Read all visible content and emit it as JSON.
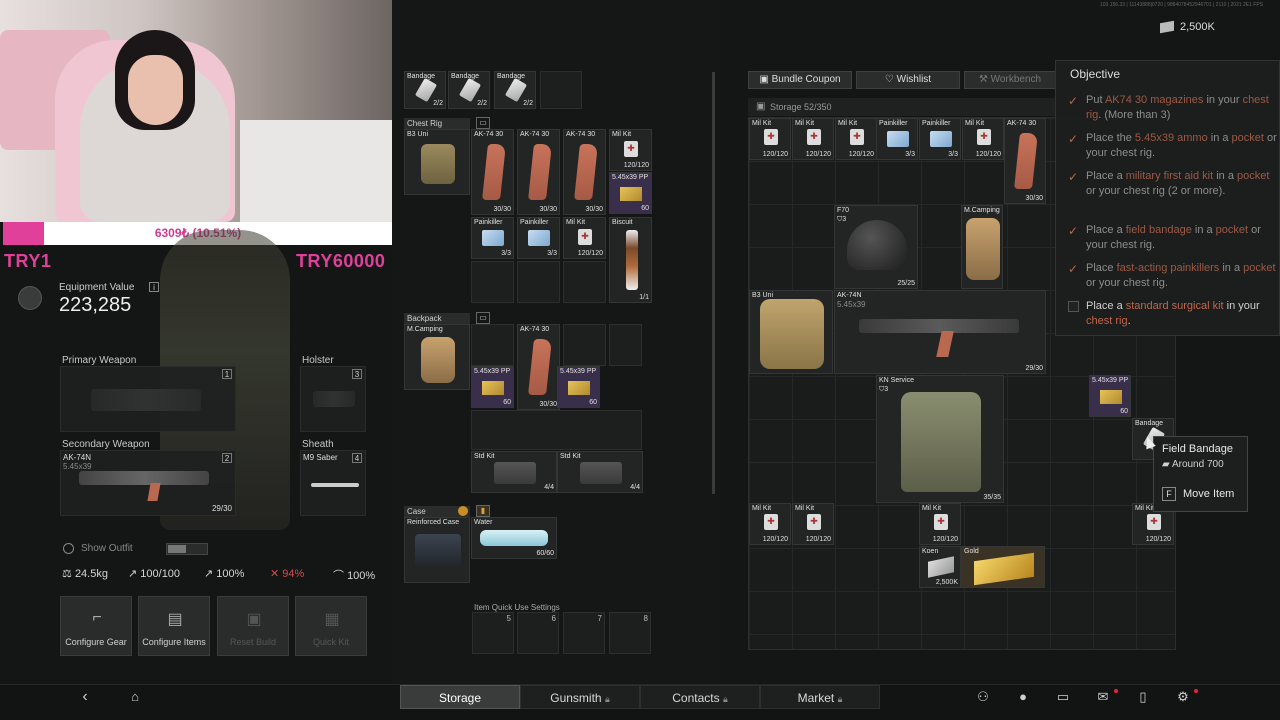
{
  "overlay": {
    "donation": "6309₺ (10.51%)",
    "try_left": "TRY1",
    "try_right": "TRY60000",
    "debug_text": "103.156.33 | 11143888|0720 | 9884078452946701 | 2110 | 2021 2E1 FPS"
  },
  "currency": {
    "amount": "2,500K"
  },
  "character": {
    "equipment_value_label": "Equipment Value",
    "equipment_value": "223,285",
    "slots": {
      "primary_label": "Primary Weapon",
      "primary_num": "1",
      "holster_label": "Holster",
      "holster_num": "3",
      "secondary_label": "Secondary Weapon",
      "secondary_num": "2",
      "secondary_name": "AK-74N",
      "secondary_sub": "5.45x39",
      "secondary_ammo": "29/30",
      "sheath_label": "Sheath",
      "sheath_num": "4",
      "sheath_name": "M9 Saber"
    },
    "show_outfit": "Show Outfit",
    "stats": {
      "weight": "24.5kg",
      "s1": "100/100",
      "s2": "100%",
      "s3": "94%",
      "s4": "100%"
    },
    "actions": {
      "configure_gear": "Configure Gear",
      "configure_items": "Configure Items",
      "reset_build": "Reset Build",
      "quick_kit": "Quick Kit"
    }
  },
  "loadout": {
    "top_row": [
      {
        "name": "Bandage",
        "qty": "2/2"
      },
      {
        "name": "Bandage",
        "qty": "2/2"
      },
      {
        "name": "Bandage",
        "qty": "2/2"
      }
    ],
    "chest_rig": {
      "label": "Chest Rig",
      "container": "B3 Uni",
      "mags": [
        {
          "name": "AK-74 30",
          "qty": "30/30"
        },
        {
          "name": "AK-74 30",
          "qty": "30/30"
        },
        {
          "name": "AK-74 30",
          "qty": "30/30"
        }
      ],
      "milkit": {
        "name": "Mil Kit",
        "qty": "120/120"
      },
      "ammo": {
        "name": "5.45x39 PP",
        "qty": "60"
      },
      "painkillers": [
        {
          "name": "Painkiller",
          "qty": "3/3"
        },
        {
          "name": "Painkiller",
          "qty": "3/3"
        }
      ],
      "milkit2": {
        "name": "Mil Kit",
        "qty": "120/120"
      },
      "biscuit": {
        "name": "Biscuit",
        "qty": "1/1"
      }
    },
    "backpack": {
      "label": "Backpack",
      "container": "M.Camping",
      "mag": {
        "name": "AK-74 30",
        "qty": "30/30"
      },
      "ammo1": {
        "name": "5.45x39 PP",
        "qty": "60"
      },
      "ammo2": {
        "name": "5.45x39 PP",
        "qty": "60"
      },
      "std1": {
        "name": "Std Kit",
        "qty": "4/4"
      },
      "std2": {
        "name": "Std Kit",
        "qty": "4/4"
      }
    },
    "case": {
      "label": "Case",
      "container": "Reinforced Case",
      "water": {
        "name": "Water",
        "qty": "60/60"
      }
    },
    "quick_use": {
      "label": "Item Quick Use Settings",
      "slots": [
        "5",
        "6",
        "7",
        "8"
      ]
    }
  },
  "stash": {
    "buttons": {
      "bundle": "Bundle Coupon",
      "wishlist": "Wishlist",
      "workbench": "Workbench"
    },
    "storage_label": "Storage 52/350",
    "items": {
      "mk1": {
        "name": "Mil Kit",
        "qty": "120/120"
      },
      "mk2": {
        "name": "Mil Kit",
        "qty": "120/120"
      },
      "mk3": {
        "name": "Mil Kit",
        "qty": "120/120"
      },
      "pk1": {
        "name": "Painkiller",
        "qty": "3/3"
      },
      "pk2": {
        "name": "Painkiller",
        "qty": "3/3"
      },
      "mk4": {
        "name": "Mil Kit",
        "qty": "120/120"
      },
      "mag": {
        "name": "AK-74 30",
        "qty": "30/30"
      },
      "helmet": {
        "name": "F70",
        "lvl": "3",
        "qty": "25/25"
      },
      "backpack": {
        "name": "M.Camping"
      },
      "rig": {
        "name": "B3 Uni"
      },
      "rifle": {
        "name": "AK-74N",
        "sub": "5.45x39",
        "qty": "29/30"
      },
      "vest": {
        "name": "KN Service",
        "lvl": "3",
        "qty": "35/35"
      },
      "ammo": {
        "name": "5.45x39 PP",
        "qty": "60"
      },
      "bandage": {
        "name": "Bandage"
      },
      "mk5": {
        "name": "Mil Kit",
        "qty": "120/120"
      },
      "mk6": {
        "name": "Mil Kit",
        "qty": "120/120"
      },
      "mk7": {
        "name": "Mil Kit",
        "qty": "120/120"
      },
      "mk8": {
        "name": "Mil Kit",
        "qty": "120/120"
      },
      "koen": {
        "name": "Koen",
        "qty": "2,500K"
      },
      "gold": {
        "name": "Gold"
      }
    }
  },
  "objective": {
    "title": "Objective",
    "items": [
      {
        "pre": "Put ",
        "hl": "AK74 30 magazines",
        "mid": " in your ",
        "hl2": "chest rig",
        "post": ". (More than 3)",
        "done": true
      },
      {
        "pre": "Place the ",
        "hl": "5.45x39 ammo",
        "mid": " in a ",
        "hl2": "pocket",
        "post": " or your chest rig.",
        "done": true
      },
      {
        "pre": "Place a ",
        "hl": "military first aid kit",
        "mid": " in a ",
        "hl2": "pocket",
        "post": " or your chest rig (2 or more).",
        "done": true
      },
      {
        "pre": "Place a ",
        "hl": "field bandage",
        "mid": " in a ",
        "hl2": "pocket",
        "post": " or your chest rig.",
        "done": true
      },
      {
        "pre": "Place ",
        "hl": "fast-acting painkillers",
        "mid": " in a ",
        "hl2": "pocket",
        "post": " or your chest rig.",
        "done": true
      },
      {
        "pre": "Place a ",
        "hl": "standard surgical kit",
        "mid": " in your ",
        "hl2": "chest rig",
        "post": ".",
        "done": false
      }
    ]
  },
  "tooltip": {
    "name": "Field Bandage",
    "value": "Around 700",
    "key": "F",
    "action": "Move Item"
  },
  "nav": {
    "storage": "Storage",
    "gunsmith": "Gunsmith",
    "contacts": "Contacts",
    "market": "Market"
  }
}
